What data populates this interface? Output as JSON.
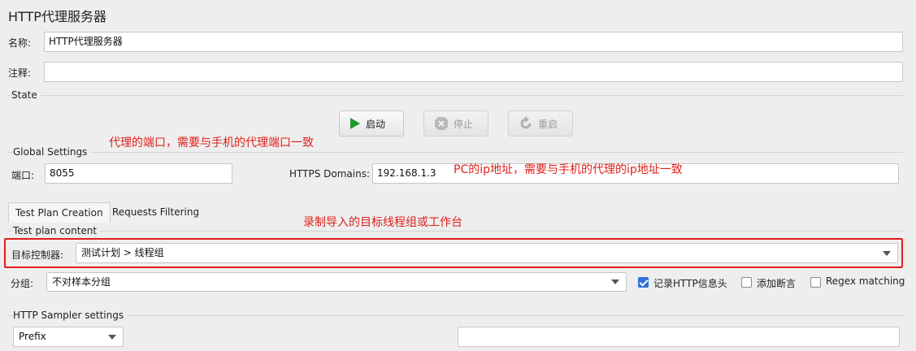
{
  "title": "HTTP代理服务器",
  "name": {
    "label": "名称:",
    "value": "HTTP代理服务器"
  },
  "comment": {
    "label": "注释:",
    "value": ""
  },
  "state": {
    "section": "State",
    "start": "启动",
    "stop": "停止",
    "restart": "重启"
  },
  "global": {
    "section": "Global Settings",
    "port_label": "端口:",
    "port_value": "8055",
    "https_label": "HTTPS Domains:",
    "https_value": "192.168.1.3"
  },
  "tabs": {
    "test_plan": "Test Plan Creation",
    "filtering": "Requests Filtering"
  },
  "content": {
    "section": "Test plan content",
    "target_label": "目标控制器:",
    "target_value": "测试计划 > 线程组",
    "group_label": "分组:",
    "group_value": "不对样本分组",
    "record_headers": "记录HTTP信息头",
    "add_assertion": "添加断言",
    "regex": "Regex matching",
    "record_headers_checked": true,
    "add_assertion_checked": false,
    "regex_checked": false
  },
  "sampler": {
    "section": "HTTP Sampler settings",
    "prefix_value": "Prefix",
    "name_value": ""
  },
  "annotations": {
    "port": "代理的端口，需要与手机的代理端口一致",
    "ip": "PC的ip地址，需要与手机的代理的ip地址一致",
    "target": "录制导入的目标线程组或工作台"
  },
  "colors": {
    "annotation": "#e0201a",
    "highlight_box": "#e31c1c",
    "checkbox": "#2f6fd6"
  }
}
